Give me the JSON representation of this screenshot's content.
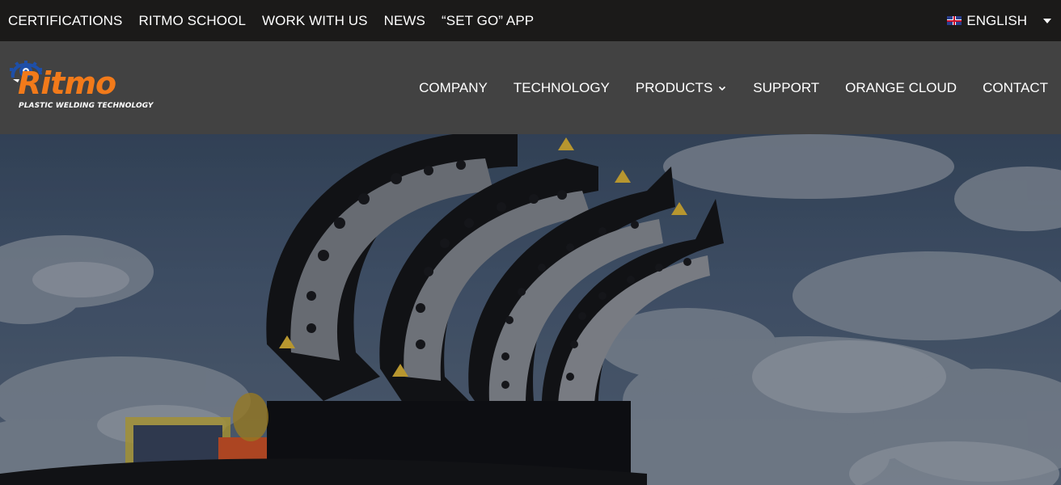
{
  "topbar": {
    "links": [
      "CERTIFICATIONS",
      "RITMO SCHOOL",
      "WORK WITH US",
      "NEWS",
      "“SET GO” APP"
    ],
    "language": "ENGLISH"
  },
  "logo": {
    "word": "Ritmo",
    "tagline": "PLASTIC WELDING TECHNOLOGY"
  },
  "mainnav": {
    "items": [
      "COMPANY",
      "TECHNOLOGY",
      "PRODUCTS",
      "SUPPORT",
      "ORANGE CLOUD",
      "CONTACT"
    ]
  },
  "colors": {
    "topbar_bg": "#1b1a19",
    "header_bg": "#424242",
    "brand_orange": "#f27a1a",
    "brand_blue": "#1e4fa8"
  },
  "icons": {
    "language_flag": "uk-flag-icon",
    "language_caret": "caret-down-icon",
    "products_chevron": "chevron-down-icon",
    "logo_mark": "gear-chameleon-icon"
  }
}
